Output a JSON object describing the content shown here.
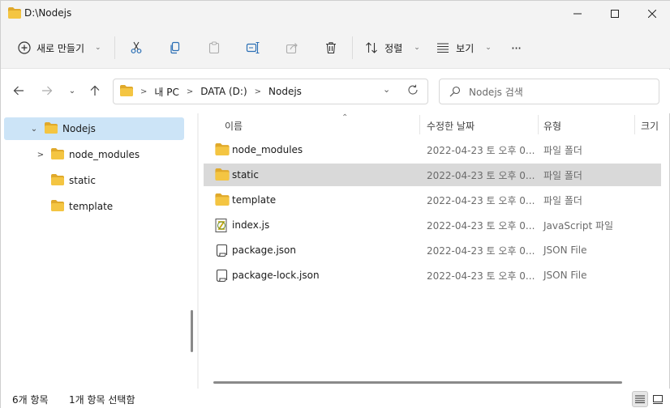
{
  "window": {
    "title": "D:\\Nodejs",
    "controls": {
      "minimize": "minimize",
      "maximize": "maximize",
      "close": "close"
    }
  },
  "toolbar": {
    "new_label": "새로 만들기",
    "sort_label": "정렬",
    "view_label": "보기",
    "more_label": "···",
    "icons": [
      "cut-icon",
      "copy-icon",
      "paste-icon",
      "rename-icon",
      "share-icon",
      "delete-icon"
    ]
  },
  "address": {
    "crumbs": [
      "내 PC",
      "DATA (D:)",
      "Nodejs"
    ]
  },
  "search": {
    "placeholder": "Nodejs 검색"
  },
  "nav_tree": {
    "items": [
      {
        "label": "Nodejs",
        "expanded": true,
        "selected": true
      },
      {
        "label": "node_modules",
        "expandable": true
      },
      {
        "label": "static"
      },
      {
        "label": "template"
      }
    ]
  },
  "columns": {
    "name": "이름",
    "date": "수정한 날짜",
    "type": "유형",
    "size": "크기"
  },
  "files": [
    {
      "name": "node_modules",
      "date": "2022-04-23 토 오후 0...",
      "type": "파일 폴더",
      "icon": "folder-icon"
    },
    {
      "name": "static",
      "date": "2022-04-23 토 오후 0...",
      "type": "파일 폴더",
      "icon": "folder-icon",
      "selected": true
    },
    {
      "name": "template",
      "date": "2022-04-23 토 오후 0...",
      "type": "파일 폴더",
      "icon": "folder-icon"
    },
    {
      "name": "index.js",
      "date": "2022-04-23 토 오후 0...",
      "type": "JavaScript 파일",
      "icon": "js-file-icon"
    },
    {
      "name": "package.json",
      "date": "2022-04-23 토 오후 0...",
      "type": "JSON File",
      "icon": "json-file-icon"
    },
    {
      "name": "package-lock.json",
      "date": "2022-04-23 토 오후 0...",
      "type": "JSON File",
      "icon": "json-file-icon"
    }
  ],
  "status": {
    "item_count": "6개 항목",
    "selection": "1개 항목 선택함"
  },
  "colors": {
    "folder": "#f4c542",
    "folder_dark": "#e0a92b",
    "selection_nav": "#cce4f7",
    "selection_row": "#d9d9d9",
    "chrome": "#f3f3f3"
  }
}
